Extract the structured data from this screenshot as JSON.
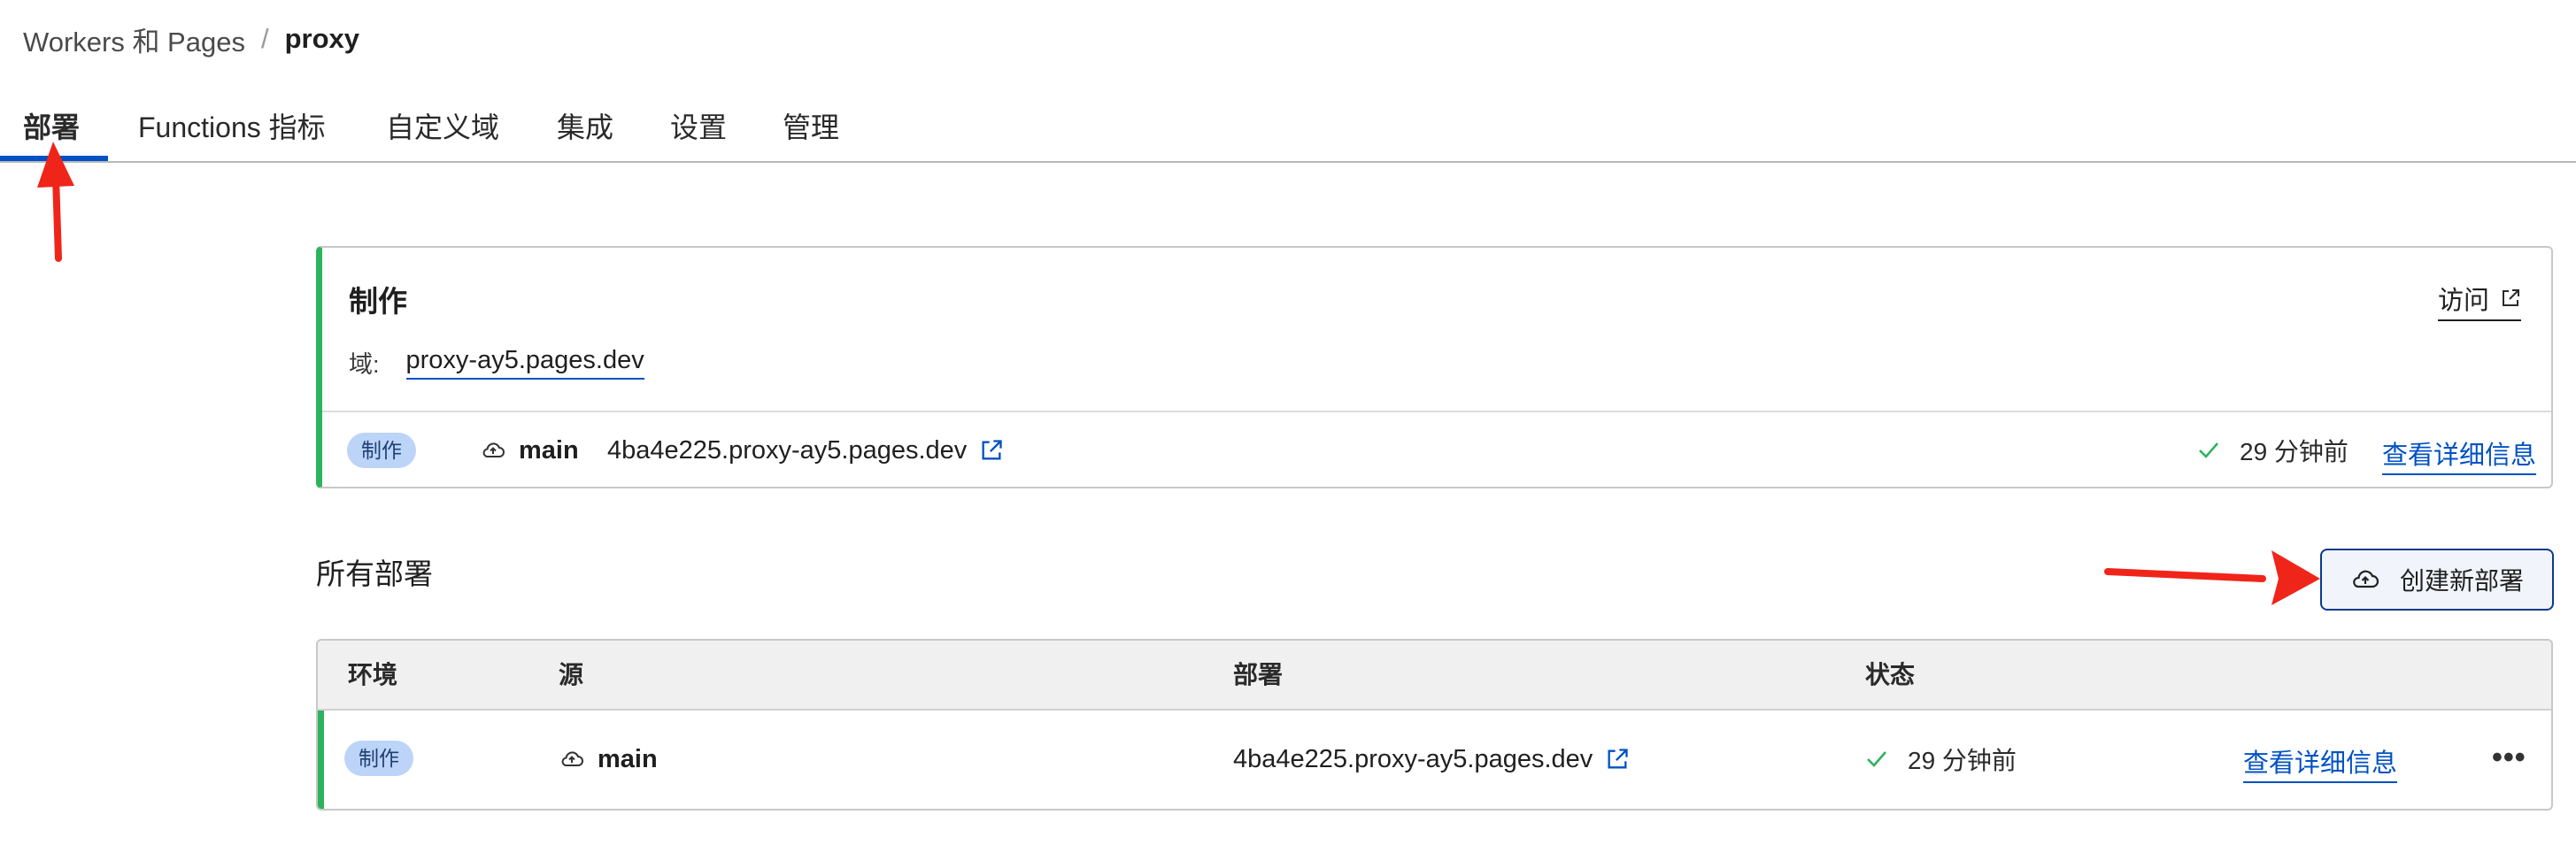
{
  "breadcrumb": {
    "parent": "Workers 和 Pages",
    "separator": "/",
    "current": "proxy"
  },
  "tabs": [
    {
      "label": "部署",
      "active": true
    },
    {
      "label": "Functions 指标"
    },
    {
      "label": "自定义域"
    },
    {
      "label": "集成"
    },
    {
      "label": "设置"
    },
    {
      "label": "管理"
    }
  ],
  "production": {
    "title": "制作",
    "visit_label": "访问",
    "domain_label": "域:",
    "domain": "proxy-ay5.pages.dev",
    "badge": "制作",
    "branch": "main",
    "deployment_url": "4ba4e225.proxy-ay5.pages.dev",
    "time": "29 分钟前",
    "details_label": "查看详细信息"
  },
  "all_deployments": {
    "title": "所有部署",
    "create_button": "创建新部署",
    "columns": [
      "环境",
      "源",
      "部署",
      "状态"
    ],
    "rows": [
      {
        "environment": "制作",
        "source": "main",
        "deployment": "4ba4e225.proxy-ay5.pages.dev",
        "status": "29 分钟前",
        "details_label": "查看详细信息",
        "more": "•••"
      }
    ]
  },
  "colors": {
    "accent": "#0051c3",
    "success": "#2db35d",
    "badge_bg": "#bcd4f8",
    "annotation": "#f0251a"
  },
  "icons": [
    "external-link-icon",
    "cloud-icon",
    "cloud-upload-icon",
    "check-icon",
    "more-icon",
    "annotation-arrow"
  ]
}
